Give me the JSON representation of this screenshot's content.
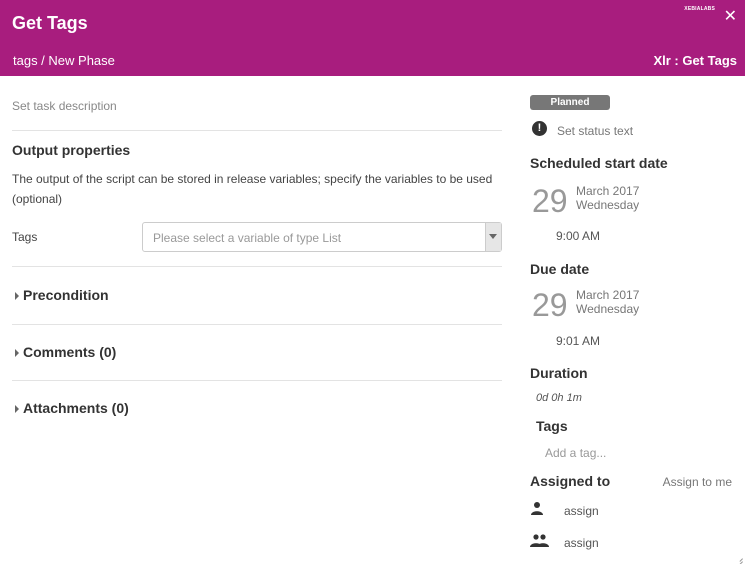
{
  "header": {
    "title": "Get Tags",
    "breadcrumb": "tags / New Phase",
    "task_ref": "Xlr : Get Tags",
    "close_glyph": "✕",
    "logo_text": "XEBIALABS",
    "background_color": "#a81d7e"
  },
  "main": {
    "description_placeholder": "Set task description",
    "output_properties": {
      "title": "Output properties",
      "help": "The output of the script can be stored in release variables; specify the variables to be used (optional)",
      "tags_label": "Tags",
      "tags_select_placeholder": "Please select a variable of type List"
    },
    "sections": {
      "precondition": "Precondition",
      "comments": "Comments (0)",
      "attachments": "Attachments (0)"
    }
  },
  "sidebar": {
    "status_badge": "Planned",
    "status_placeholder": "Set status text",
    "scheduled_start": {
      "label": "Scheduled start date",
      "day": "29",
      "month_year": "March 2017",
      "weekday": "Wednesday",
      "time": "9:00 AM"
    },
    "due_date": {
      "label": "Due date",
      "day": "29",
      "month_year": "March 2017",
      "weekday": "Wednesday",
      "time": "9:01 AM"
    },
    "duration": {
      "label": "Duration",
      "value": "0d 0h 1m"
    },
    "tags": {
      "label": "Tags",
      "add_placeholder": "Add a tag..."
    },
    "assigned_to": {
      "label": "Assigned to",
      "assign_to_me": "Assign to me",
      "user_assign": "assign",
      "team_assign": "assign"
    }
  },
  "icons": {
    "close": "close-icon",
    "caret": "caret-down-icon",
    "section_arrow": "chevron-right-icon",
    "status": "exclamation-icon",
    "user": "user-icon",
    "team": "users-icon"
  }
}
